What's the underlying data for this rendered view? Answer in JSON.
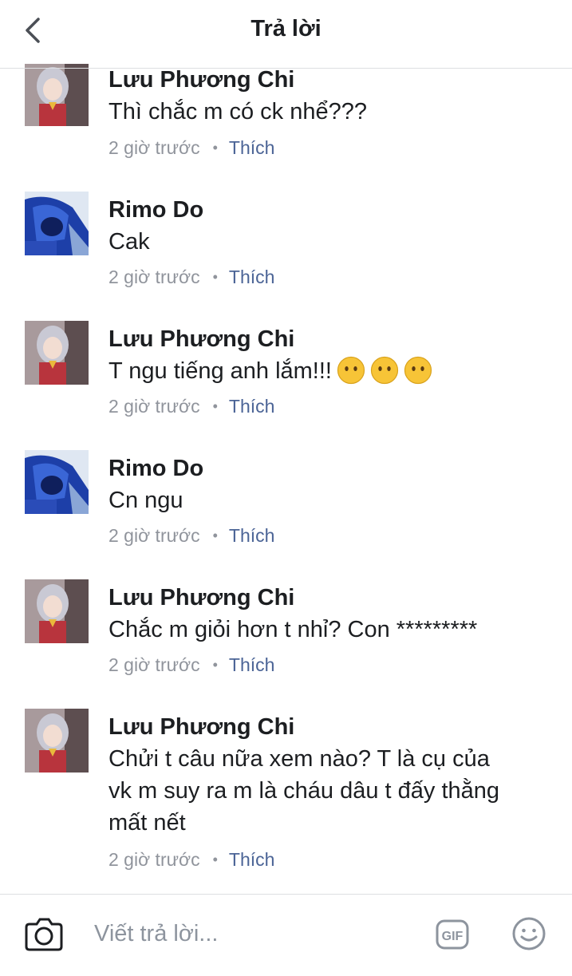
{
  "header": {
    "title": "Trả lời",
    "back_icon": "chevron-left-icon"
  },
  "comments": [
    {
      "author": "Lưu Phương Chi",
      "text": "Thì chắc m có ck nhể???",
      "time": "2 giờ trước",
      "like": "Thích",
      "avatar": "anime-girl-avatar",
      "emoji_count": 0
    },
    {
      "author": "Rimo Do",
      "text": "Cak",
      "time": "2 giờ trước",
      "like": "Thích",
      "avatar": "anime-boy-avatar",
      "emoji_count": 0
    },
    {
      "author": "Lưu Phương Chi",
      "text": "T ngu tiếng anh lắm!!!",
      "time": "2 giờ trước",
      "like": "Thích",
      "avatar": "anime-girl-avatar",
      "emoji_count": 3,
      "emoji": "no-mouth-face-emoji"
    },
    {
      "author": "Rimo Do",
      "text": "Cn ngu",
      "time": "2 giờ trước",
      "like": "Thích",
      "avatar": "anime-boy-avatar",
      "emoji_count": 0
    },
    {
      "author": "Lưu Phương Chi",
      "text": "Chắc m giỏi hơn t nhỉ? Con *********",
      "time": "2 giờ trước",
      "like": "Thích",
      "avatar": "anime-girl-avatar",
      "emoji_count": 0
    },
    {
      "author": "Lưu Phương Chi",
      "text_lines": [
        "Chửi t câu nữa xem nào? T là cụ của",
        "vk m suy ra m là cháu dâu t đấy thằng",
        "mất nết"
      ],
      "time": "2 giờ trước",
      "like": "Thích",
      "avatar": "anime-girl-avatar",
      "emoji_count": 0
    }
  ],
  "composer": {
    "placeholder": "Viết trả lời...",
    "camera_icon": "camera-icon",
    "gif_label": "GIF",
    "emoji_icon": "smiley-icon"
  },
  "colors": {
    "text": "#1c1e21",
    "meta": "#90949c",
    "like": "#4b6496",
    "divider": "#dddfe2",
    "emoji": "#f7c437"
  }
}
